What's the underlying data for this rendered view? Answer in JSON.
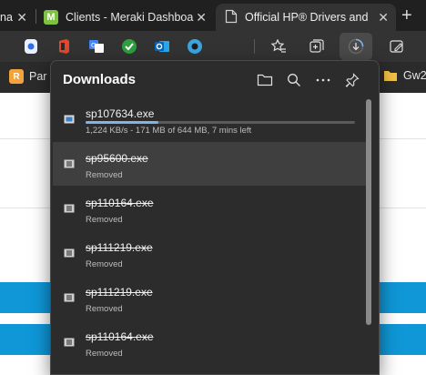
{
  "browser": {
    "tabs": [
      {
        "title": "na",
        "active": false
      },
      {
        "title": "Clients - Meraki Dashboa",
        "favicon_letter": "M",
        "active": false
      },
      {
        "title": "Official HP® Drivers and",
        "active": true
      }
    ]
  },
  "favorites_bar": [
    {
      "label": "Par",
      "icon": "rpa-icon"
    },
    {
      "label": "Gw2",
      "icon": "folder-icon"
    }
  ],
  "downloads": {
    "title": "Downloads",
    "items": [
      {
        "name": "sp107634.exe",
        "status": "1,224 KB/s - 171 MB of 644 MB, 7 mins left",
        "progress": 0.27,
        "removed": false
      },
      {
        "name": "sp95600.exe",
        "status": "Removed",
        "removed": true
      },
      {
        "name": "sp110164.exe",
        "status": "Removed",
        "removed": true
      },
      {
        "name": "sp111219.exe",
        "status": "Removed",
        "removed": true
      },
      {
        "name": "sp111219.exe",
        "status": "Removed",
        "removed": true
      },
      {
        "name": "sp110164.exe",
        "status": "Removed",
        "removed": true
      }
    ]
  },
  "colors": {
    "accent": "#7fb4e8",
    "flyout_bg": "#2c2c2c",
    "page_blue": "#0f97d7"
  }
}
